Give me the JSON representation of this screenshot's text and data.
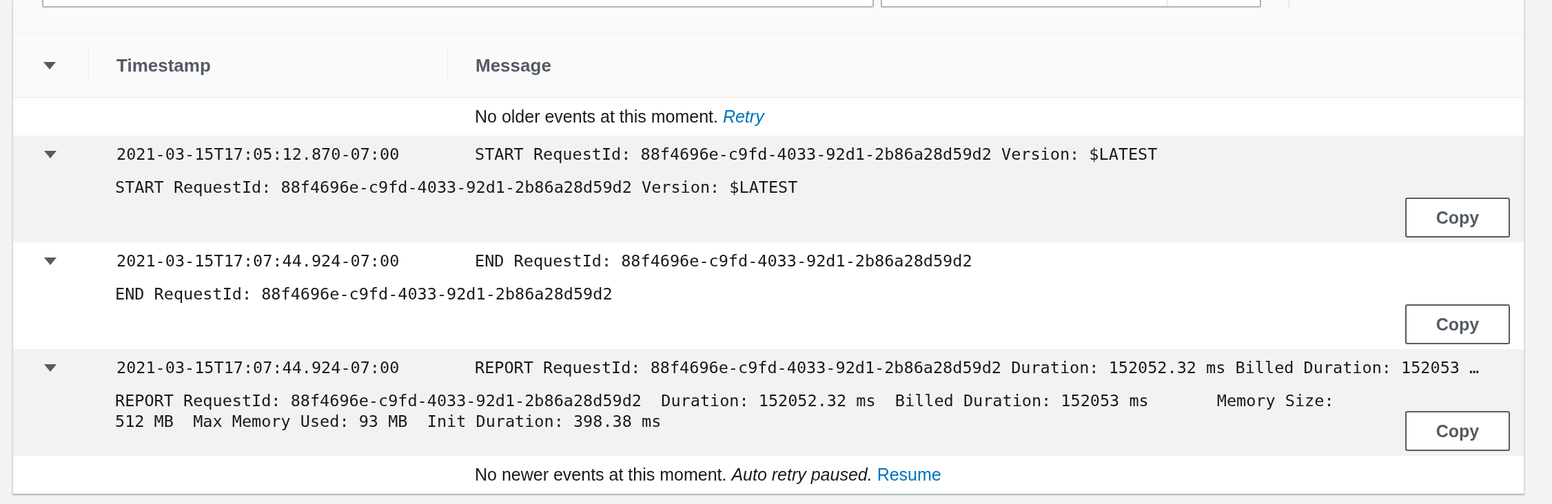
{
  "table": {
    "columns": [
      {
        "label": "Timestamp"
      },
      {
        "label": "Message"
      }
    ],
    "header_expanded": true
  },
  "top_status": {
    "message": "No older events at this moment.",
    "link": "Retry"
  },
  "rows": [
    {
      "expanded": true,
      "timestamp": "2021-03-15T17:05:12.870-07:00",
      "message": "START RequestId: 88f4696e-c9fd-4033-92d1-2b86a28d59d2 Version: $LATEST",
      "detail": "START RequestId: 88f4696e-c9fd-4033-92d1-2b86a28d59d2 Version: $LATEST",
      "copy": "Copy"
    },
    {
      "expanded": true,
      "timestamp": "2021-03-15T17:07:44.924-07:00",
      "message": "END RequestId: 88f4696e-c9fd-4033-92d1-2b86a28d59d2",
      "detail": "END RequestId: 88f4696e-c9fd-4033-92d1-2b86a28d59d2",
      "copy": "Copy"
    },
    {
      "expanded": true,
      "timestamp": "2021-03-15T17:07:44.924-07:00",
      "message": "REPORT RequestId: 88f4696e-c9fd-4033-92d1-2b86a28d59d2 Duration: 152052.32 ms Billed Duration: 152053 …",
      "detail": "REPORT RequestId: 88f4696e-c9fd-4033-92d1-2b86a28d59d2  Duration: 152052.32 ms  Billed Duration: 152053 ms       Memory Size: 512 MB  Max Memory Used: 93 MB  Init Duration: 398.38 ms",
      "copy": "Copy"
    }
  ],
  "bottom_status": {
    "message": "No newer events at this moment. *Auto retry paused.*",
    "link": "Resume"
  }
}
